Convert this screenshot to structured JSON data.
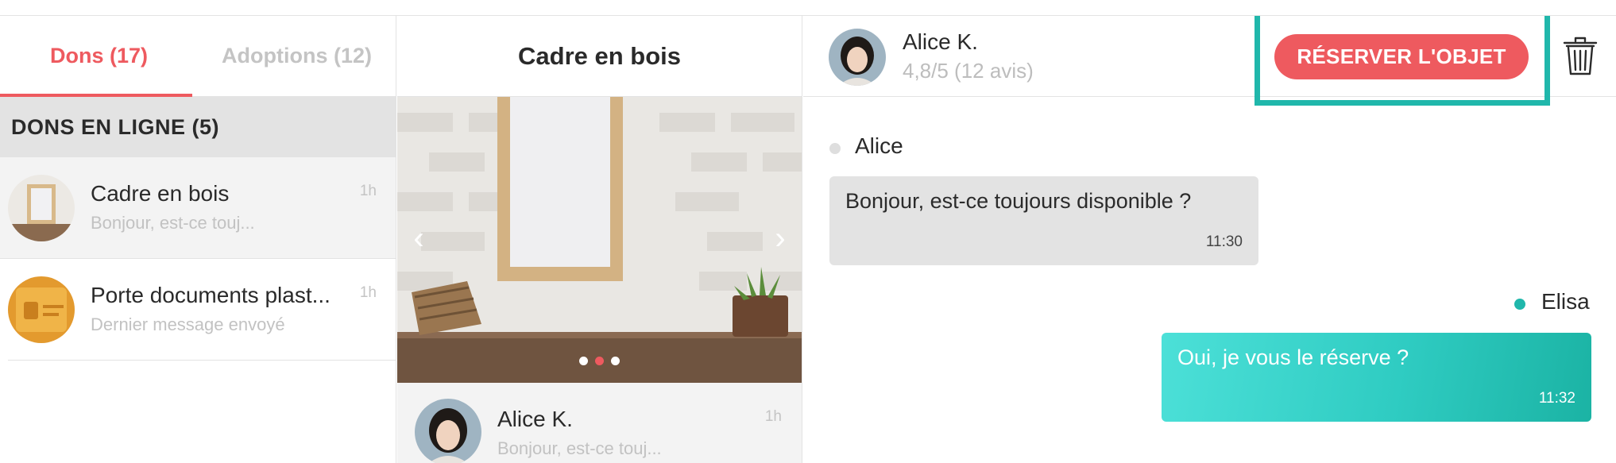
{
  "tabs": [
    {
      "label": "Dons (17)",
      "active": true
    },
    {
      "label": "Adoptions (12)",
      "active": false
    }
  ],
  "section_header": "DONS EN LIGNE (5)",
  "conversations": [
    {
      "title": "Cadre en bois",
      "subtitle": "Bonjour, est-ce touj...",
      "time": "1h",
      "icon": "wooden-frame-thumbnail"
    },
    {
      "title": "Porte documents plast...",
      "subtitle": "Dernier message envoyé",
      "time": "1h",
      "icon": "document-holder-thumbnail"
    }
  ],
  "item_panel": {
    "title": "Cadre en bois",
    "gallery": {
      "image": "wooden-frame-photo",
      "slide_count": 3,
      "active_slide": 1
    },
    "conversation": {
      "name": "Alice K.",
      "subtitle": "Bonjour, est-ce touj...",
      "time": "1h"
    }
  },
  "chat": {
    "header": {
      "name": "Alice K.",
      "rating": "4,8/5 (12 avis)",
      "reserve_label": "RÉSERVER L'OBJET",
      "trash_icon": "trash-icon"
    },
    "messages": [
      {
        "sender": "Alice",
        "text": "Bonjour, est-ce toujours disponible ?",
        "time": "11:30",
        "direction": "in"
      },
      {
        "sender": "Elisa",
        "text": "Oui, je vous le réserve ?",
        "time": "11:32",
        "direction": "out"
      }
    ]
  },
  "colors": {
    "accent": "#ee5a5f",
    "teal": "#20b7ab",
    "muted": "#c4c4c4"
  }
}
